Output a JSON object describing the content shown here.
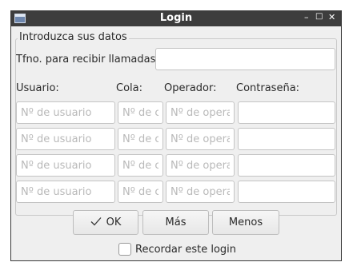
{
  "window": {
    "title": "Login",
    "minimize_icon": "minimize-icon",
    "maximize_icon": "maximize-icon",
    "close_icon": "close-icon"
  },
  "group": {
    "title": "Introduzca sus datos"
  },
  "phone": {
    "label": "Tfno. para recibir llamadas:",
    "value": ""
  },
  "columns": {
    "user": "Usuario:",
    "queue": "Cola:",
    "operator": "Operador:",
    "password": "Contraseña:"
  },
  "placeholders": {
    "user": "Nº de usuario",
    "queue": "Nº de cola",
    "operator": "Nº de operador",
    "password": ""
  },
  "rows": [
    {},
    {},
    {},
    {}
  ],
  "buttons": {
    "ok": "OK",
    "ok_icon": "checkmark-icon",
    "more": "Más",
    "less": "Menos"
  },
  "remember": {
    "label": "Recordar este login",
    "checked": false
  }
}
